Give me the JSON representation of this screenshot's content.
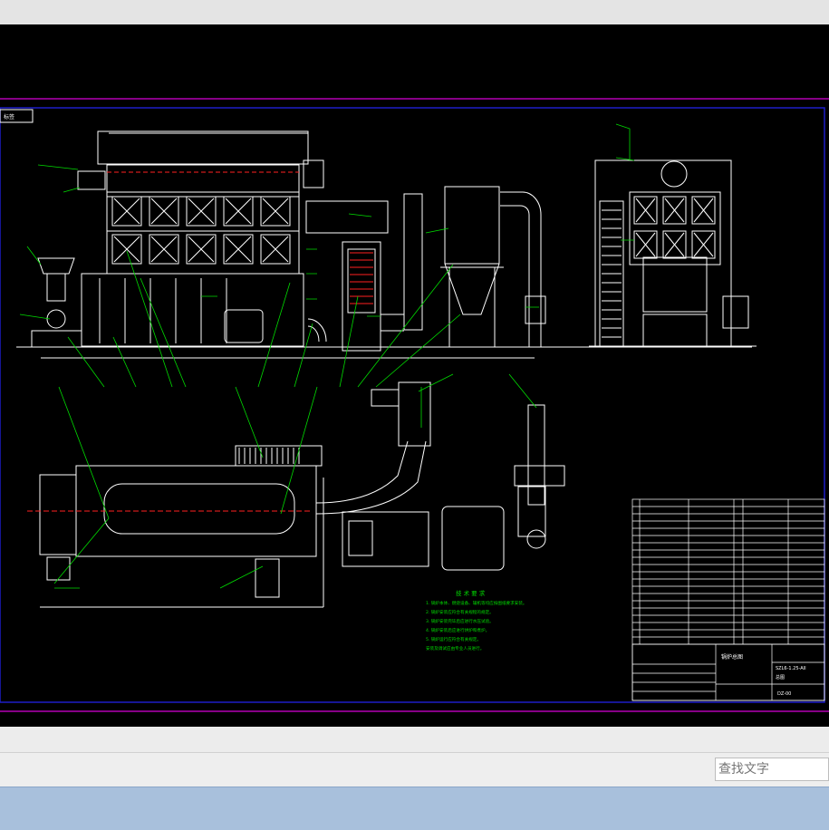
{
  "drawing": {
    "title_tag": "标签",
    "title_block_name": "锅炉总图",
    "drawing_number": "SZL6-1.25-AII",
    "drawing_type": "总图",
    "sheet_code": "DZ-00",
    "notes_title": "技 术 要 求",
    "notes": [
      "1. 锅炉本体、燃烧设备、辅机等均应按图纸要求安装。",
      "2. 锅炉安装应符合有关规程的规定。",
      "3. 锅炉安装完毕后应进行水压试验。",
      "4. 锅炉安装后应进行烘炉和煮炉。",
      "5. 锅炉运行应符合有关规定。",
      "   安装及调试应由专业人员进行。"
    ],
    "parts_table_rows": 19
  },
  "colors": {
    "canvas": "#000000",
    "frame": "#1e1ec8",
    "border": "#b400b4",
    "line": "#ffffff",
    "leader": "#00dc00",
    "centerline": "#ff2020"
  },
  "search": {
    "placeholder": "查找文字"
  }
}
